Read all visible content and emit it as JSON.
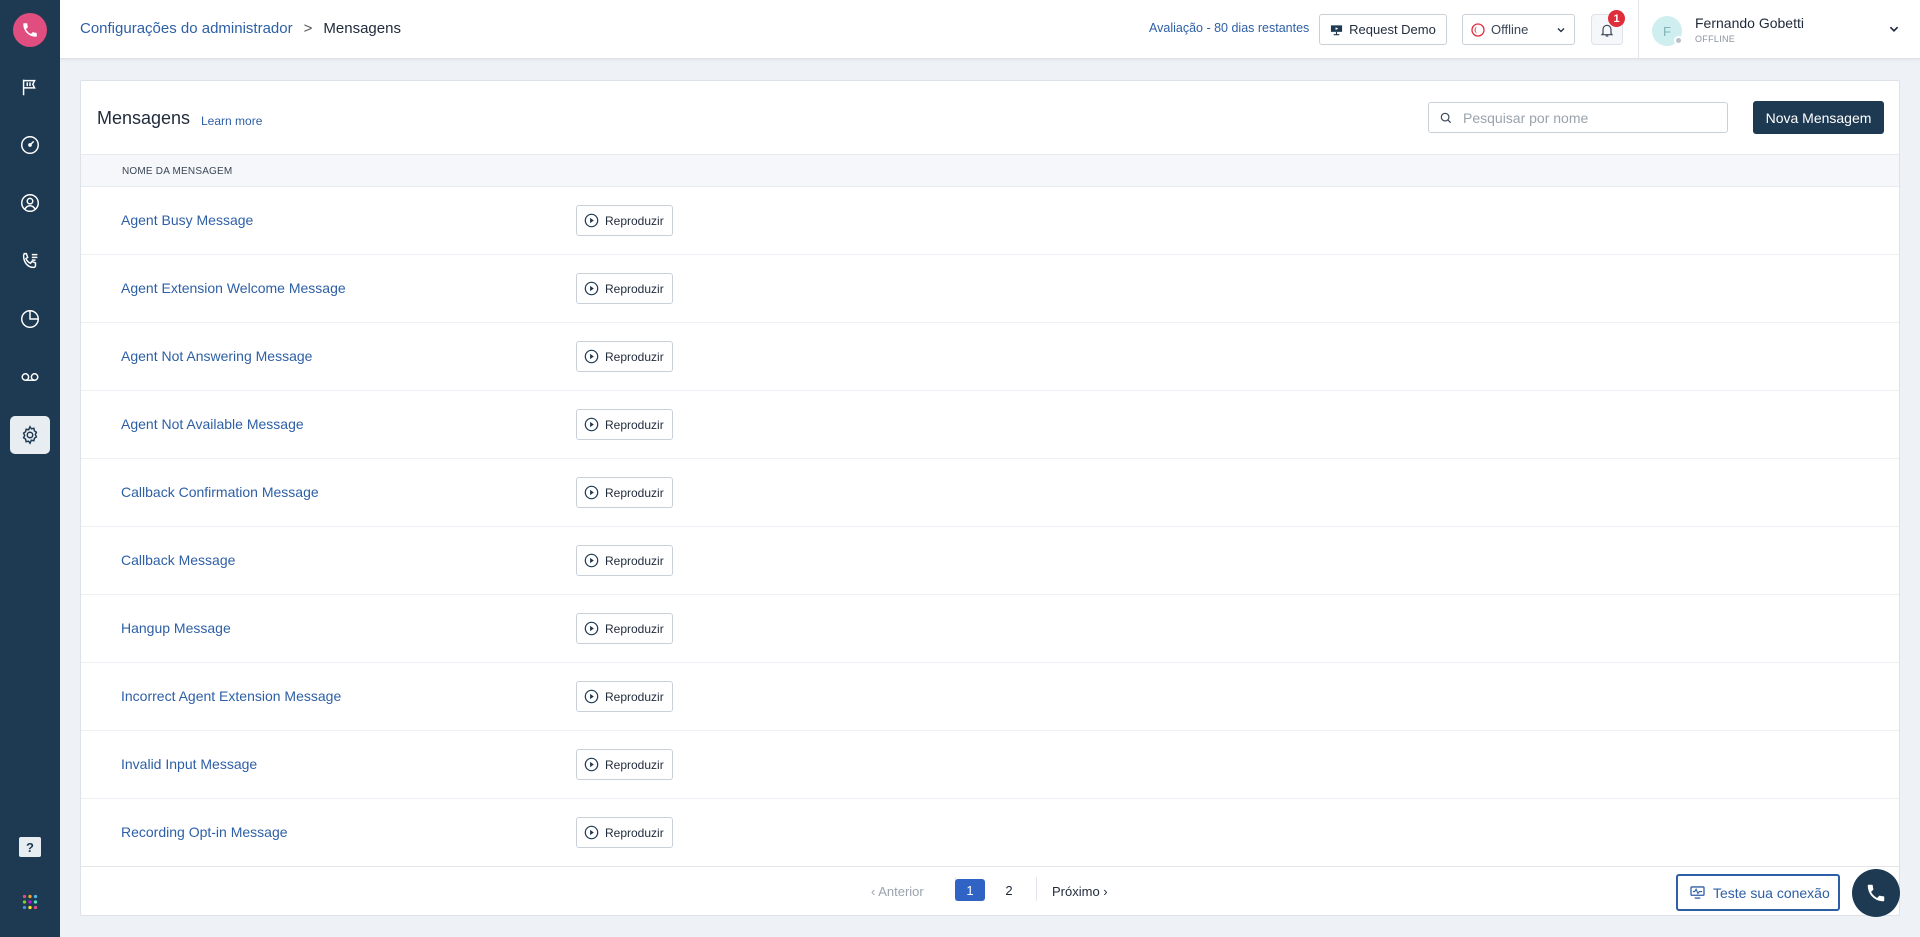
{
  "sidebar": {
    "logo_icon": "phone-icon",
    "accent": "#e04e7f",
    "nav": [
      {
        "name": "flag-icon"
      },
      {
        "name": "dashboard-icon"
      },
      {
        "name": "user-icon"
      },
      {
        "name": "call-routing-icon"
      },
      {
        "name": "reports-icon"
      },
      {
        "name": "voicemail-icon"
      },
      {
        "name": "settings-icon",
        "active": true
      }
    ],
    "help_label": "?"
  },
  "header": {
    "breadcrumb": {
      "parent": "Configurações do administrador",
      "separator": ">",
      "current": "Mensagens"
    },
    "trial": "Avaliação - 80 dias restantes",
    "request_demo": "Request Demo",
    "status_value": "Offline",
    "notifications_count": "1",
    "user": {
      "initial": "F",
      "name": "Fernando Gobetti",
      "status": "OFFLINE"
    }
  },
  "main": {
    "title": "Mensagens",
    "learn_more": "Learn more",
    "search_placeholder": "Pesquisar por nome",
    "new_button": "Nova Mensagem",
    "column_header": "NOME DA MENSAGEM",
    "play_label": "Reproduzir",
    "rows": [
      "Agent Busy Message",
      "Agent Extension Welcome Message",
      "Agent Not Answering Message",
      "Agent Not Available Message",
      "Callback Confirmation Message",
      "Callback Message",
      "Hangup Message",
      "Incorrect Agent Extension Message",
      "Invalid Input Message",
      "Recording Opt-in Message"
    ]
  },
  "pagination": {
    "prev": "‹ Anterior",
    "pages": [
      "1",
      "2"
    ],
    "current": "1",
    "next": "Próximo ›"
  },
  "footer": {
    "test_connection": "Teste sua conexão"
  }
}
